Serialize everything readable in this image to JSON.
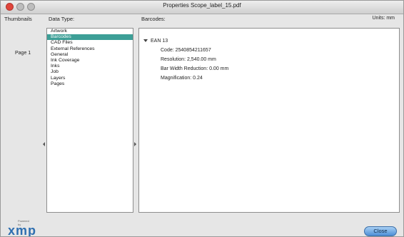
{
  "window": {
    "title": "Properties Scope_label_15.pdf"
  },
  "headers": {
    "thumbnails": "Thumbnails",
    "data_type": "Data Type:",
    "barcodes": "Barcodes:",
    "units": "Units: mm"
  },
  "thumbnails": {
    "page_label": "Page 1"
  },
  "data_types": [
    {
      "label": "Artwork"
    },
    {
      "label": "Barcodes"
    },
    {
      "label": "CAD Files"
    },
    {
      "label": "External References"
    },
    {
      "label": "General"
    },
    {
      "label": "Ink Coverage"
    },
    {
      "label": "Inks"
    },
    {
      "label": "Job"
    },
    {
      "label": "Layers"
    },
    {
      "label": "Pages"
    }
  ],
  "selected_data_type": "Barcodes",
  "barcode": {
    "name": "EAN 13",
    "properties": [
      "Code: 2540854211657",
      "Resolution: 2,540.00 mm",
      "Bar Width Reduction: 0.00 mm",
      "Magnification: 0.24"
    ]
  },
  "footer": {
    "powered_by": "Powered by",
    "logo_text": "xmp",
    "close_label": "Close"
  },
  "colors": {
    "selection": "#3d9f97",
    "close_button": "#4d8fd6"
  }
}
